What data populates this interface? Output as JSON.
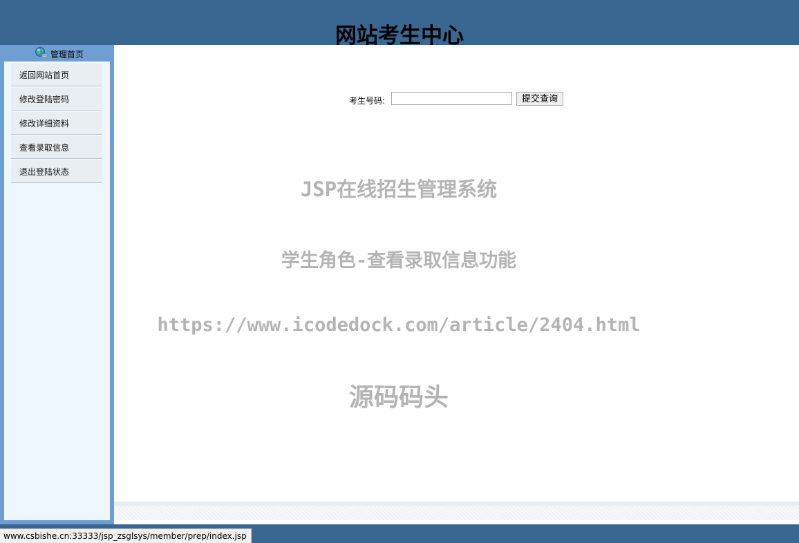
{
  "header": {
    "title": "网站考生中心"
  },
  "sidebar": {
    "head_label": "管理首页",
    "head_icon": "globe-icon",
    "items": [
      {
        "label": "返回网站首页"
      },
      {
        "label": "修改登陆密码"
      },
      {
        "label": "修改详细资料"
      },
      {
        "label": "查看录取信息"
      },
      {
        "label": "退出登陆状态"
      }
    ]
  },
  "search": {
    "label": "考生号码:",
    "value": "",
    "button_label": "提交查询"
  },
  "watermark": {
    "line1": "JSP在线招生管理系统",
    "line2": "学生角色-查看录取信息功能",
    "line3": "https://www.icodedock.com/article/2404.html",
    "line4": "源码码头"
  },
  "status_bar": {
    "url": "www.csbishe.cn:33333/jsp_zsglsys/member/prep/index.jsp"
  },
  "colors": {
    "header_bg": "#3a6692",
    "sidebar_bg": "#6f9fd2",
    "panel_bg": "#eef7fe",
    "watermark": "#b4b4b4"
  }
}
